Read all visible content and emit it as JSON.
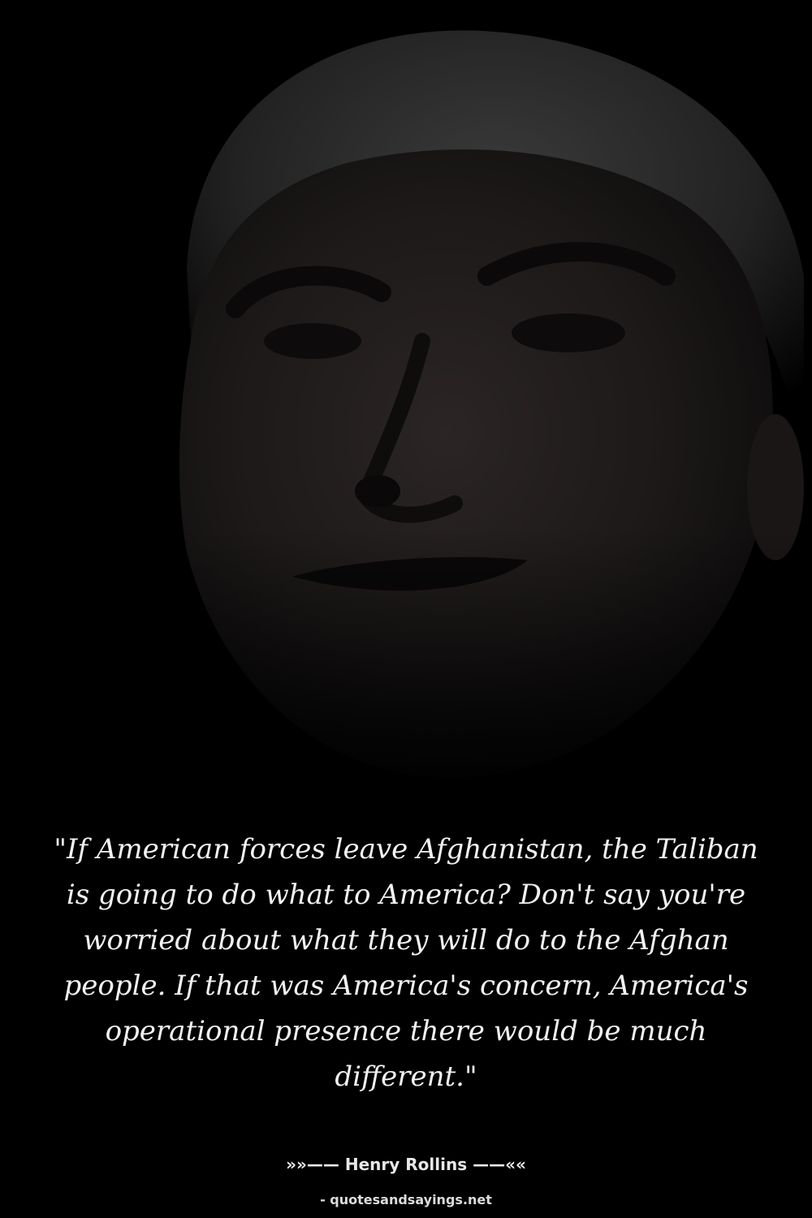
{
  "quote": {
    "text": "\"If American forces leave Afghanistan, the Taliban is going to do what to America? Don't say you're worried about what they will do to the Afghan people. If that was America's concern, America's operational presence there would be much different.\""
  },
  "attribution": {
    "text": "»»—— Henry Rollins ——««"
  },
  "source": {
    "text": "- quotesandsayings.net"
  },
  "colors": {
    "background": "#000000",
    "text": "#f2f2f2"
  }
}
